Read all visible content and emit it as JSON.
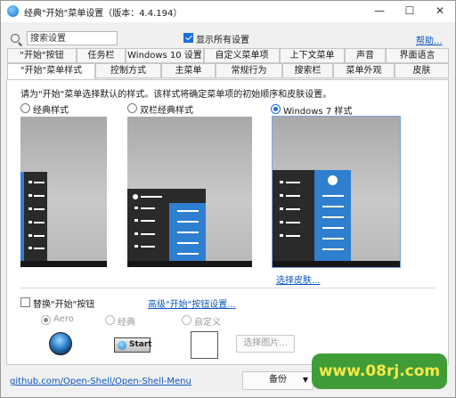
{
  "window": {
    "title": "经典\"开始\"菜单设置（版本：4.4.194）",
    "controls": {
      "minimize": "—",
      "maximize": "☐",
      "close": "✕"
    }
  },
  "toolbar": {
    "search_placeholder": "搜索设置",
    "show_all_label": "显示所有设置",
    "show_all_checked": true,
    "help_label": "帮助..."
  },
  "tabs_row1": [
    "\"开始\"按钮",
    "任务栏",
    "Windows 10 设置",
    "自定义菜单项",
    "上下文菜单",
    "声音",
    "界面语言"
  ],
  "tabs_row2": [
    "\"开始\"菜单样式",
    "控制方式",
    "主菜单",
    "常规行为",
    "搜索栏",
    "菜单外观",
    "皮肤"
  ],
  "active_tab": "\"开始\"菜单样式",
  "panel": {
    "description": "请为\"开始\"菜单选择默认的样式。该样式将确定菜单项的初始顺序和皮肤设置。",
    "styles": [
      {
        "label": "经典样式",
        "selected": false
      },
      {
        "label": "双栏经典样式",
        "selected": false
      },
      {
        "label": "Windows 7 样式",
        "selected": true
      }
    ],
    "select_skin_link": "选择皮肤...",
    "replace_start_label": "替换\"开始\"按钮",
    "replace_start_checked": false,
    "advanced_link": "高级\"开始\"按钮设置...",
    "button_styles": [
      {
        "label": "Aero",
        "selected": true
      },
      {
        "label": "经典",
        "selected": false
      },
      {
        "label": "自定义",
        "selected": false
      }
    ],
    "start_button_text": "Start",
    "select_image_button": "选择图片..."
  },
  "footer": {
    "github_link": "github.com/Open-Shell/Open-Shell-Menu",
    "backup_button": "备份",
    "backup_arrow": "▼"
  },
  "watermark": "www.08rj.com",
  "colors": {
    "accent": "#1a6fd6",
    "menu_blue": "#2f7fd0",
    "link": "#0a57c2",
    "watermark_bg": "#3f9c36",
    "watermark_text": "#f6e94a"
  }
}
